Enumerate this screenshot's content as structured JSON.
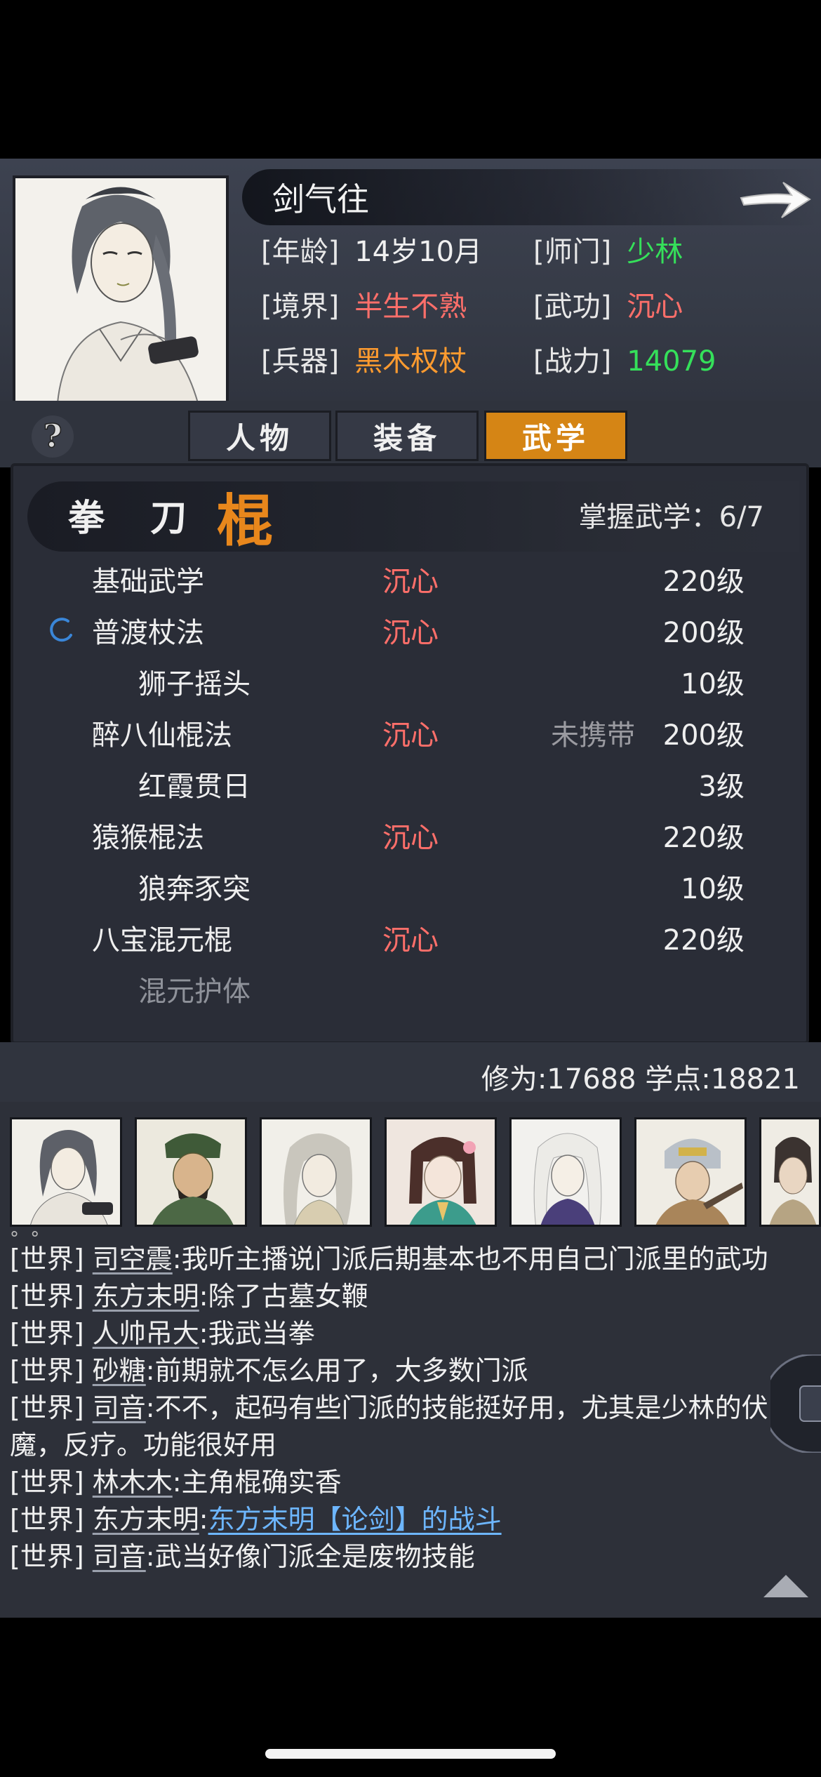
{
  "character": {
    "name": "剑气往",
    "attributes": [
      {
        "key": "[年龄]",
        "value": "14岁10月",
        "color": "#f0f0f0"
      },
      {
        "key": "[师门]",
        "value": "少林",
        "color": "#35e05a"
      },
      {
        "key": "[境界]",
        "value": "半生不熟",
        "color": "#ff6f6a"
      },
      {
        "key": "[武功]",
        "value": "沉心",
        "color": "#ff6f6a"
      },
      {
        "key": "[兵器]",
        "value": "黑木权杖",
        "color": "#ff9b2f"
      },
      {
        "key": "[战力]",
        "value": "14079",
        "color": "#35e05a"
      }
    ]
  },
  "tabs": [
    {
      "label": "人物",
      "active": false
    },
    {
      "label": "装备",
      "active": false
    },
    {
      "label": "武学",
      "active": true
    }
  ],
  "categories": [
    {
      "label": "拳",
      "active": false
    },
    {
      "label": "刀",
      "active": false
    },
    {
      "label": "棍",
      "active": true
    }
  ],
  "mastery": "掌握武学：6/7",
  "skills": [
    {
      "name": "基础武学",
      "school": "沉心",
      "carry": "",
      "level": "220级",
      "sub": false,
      "dim": false,
      "spinner": false
    },
    {
      "name": "普渡杖法",
      "school": "沉心",
      "carry": "",
      "level": "200级",
      "sub": false,
      "dim": false,
      "spinner": true
    },
    {
      "name": "狮子摇头",
      "school": "",
      "carry": "",
      "level": "10级",
      "sub": true,
      "dim": false,
      "spinner": false
    },
    {
      "name": "醉八仙棍法",
      "school": "沉心",
      "carry": "未携带",
      "level": "200级",
      "sub": false,
      "dim": false,
      "spinner": false
    },
    {
      "name": "红霞贯日",
      "school": "",
      "carry": "",
      "level": "3级",
      "sub": true,
      "dim": false,
      "spinner": false
    },
    {
      "name": "猿猴棍法",
      "school": "沉心",
      "carry": "",
      "level": "220级",
      "sub": false,
      "dim": false,
      "spinner": false
    },
    {
      "name": "狼奔豕突",
      "school": "",
      "carry": "",
      "level": "10级",
      "sub": true,
      "dim": false,
      "spinner": false
    },
    {
      "name": "八宝混元棍",
      "school": "沉心",
      "carry": "",
      "level": "220级",
      "sub": false,
      "dim": false,
      "spinner": false
    },
    {
      "name": "混元护体",
      "school": "",
      "carry": "",
      "level": "",
      "sub": true,
      "dim": true,
      "spinner": false
    }
  ],
  "stats": "修为:17688  学点:18821",
  "chat": {
    "dots": "° °",
    "messages": [
      {
        "tag": "[世界]",
        "user": "司空震",
        "text": ":我听主播说门派后期基本也不用自己门派里的武功",
        "link": ""
      },
      {
        "tag": "[世界]",
        "user": "东方末明",
        "text": ":除了古墓女鞭",
        "link": ""
      },
      {
        "tag": "[世界]",
        "user": "人帅吊大",
        "text": ":我武当拳",
        "link": ""
      },
      {
        "tag": "[世界]",
        "user": "砂糖",
        "text": ":前期就不怎么用了，大多数门派",
        "link": ""
      },
      {
        "tag": "[世界]",
        "user": "司音",
        "text": ":不不，起码有些门派的技能挺好用，尤其是少林的伏魔，反疗。功能很好用",
        "link": ""
      },
      {
        "tag": "[世界]",
        "user": "林木木",
        "text": ":主角棍确实香",
        "link": ""
      },
      {
        "tag": "[世界]",
        "user": "东方末明",
        "text": ":",
        "link": "东方末明【论剑】的战斗"
      },
      {
        "tag": "[世界]",
        "user": "司音",
        "text": ":武当好像门派全是废物技能",
        "link": ""
      }
    ]
  }
}
